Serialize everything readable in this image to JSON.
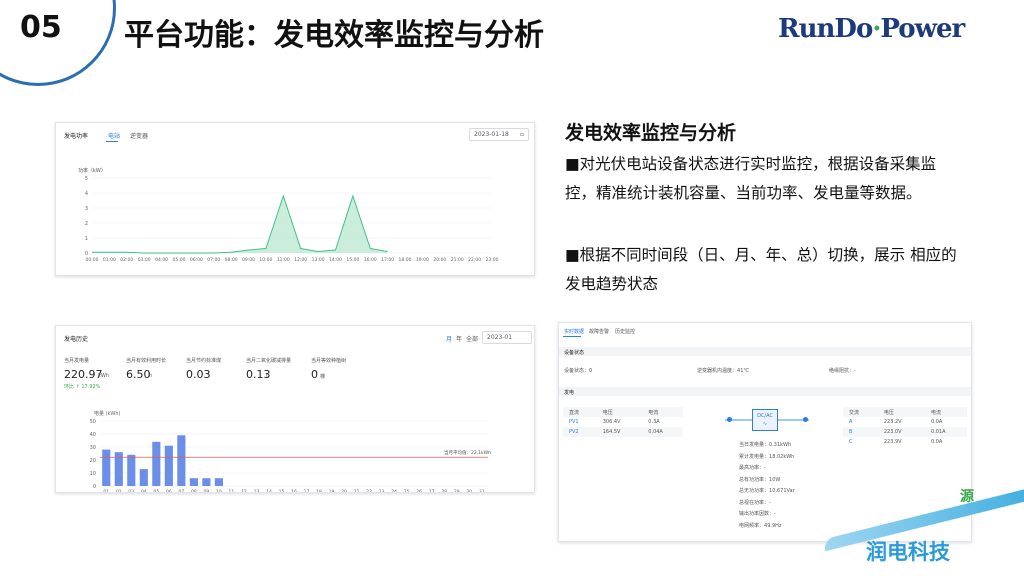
{
  "header": {
    "number": "05",
    "title": "平台功能：发电效率监控与分析",
    "logo_left": "RunDo",
    "logo_dot": "·",
    "logo_right": "Power"
  },
  "right_panel": {
    "title": "发电效率监控与分析",
    "bullets": [
      "■对光伏电站设备状态进行实时监控，根据设备采集监控，精准统计装机容量、当前功率、发电量等数据。",
      "■根据不同时间段（日、月、年、总）切换，展示 相应的发电趋势状态"
    ]
  },
  "power_card": {
    "title": "发电功率",
    "tabs": [
      "电站",
      "逆变器"
    ],
    "date": "2023-01-18",
    "ylabel": "功率（kW）",
    "y_ticks": [
      "0",
      "1",
      "2",
      "3",
      "4",
      "5"
    ],
    "x_ticks": [
      "00:00",
      "01:00",
      "02:00",
      "03:00",
      "04:00",
      "05:00",
      "06:00",
      "07:00",
      "08:00",
      "09:00",
      "10:00",
      "11:00",
      "12:00",
      "13:00",
      "14:00",
      "15:00",
      "16:00",
      "17:00",
      "18:00",
      "19:00",
      "20:00",
      "21:00",
      "22:00",
      "23:00"
    ]
  },
  "history_card": {
    "title": "发电历史",
    "switch": [
      "月",
      "年",
      "全部"
    ],
    "month": "2023-01",
    "stats": [
      {
        "label": "当月发电量",
        "value": "220.97",
        "unit": "kWh"
      },
      {
        "label": "当月有效利用时长",
        "value": "6.50",
        "unit": "h"
      },
      {
        "label": "当月节约标准煤",
        "value": "0.03",
        "unit": "t"
      },
      {
        "label": "当月二氧化碳减排量",
        "value": "0.13",
        "unit": "t"
      },
      {
        "label": "当月等效种植树",
        "value": "0",
        "unit": "棵"
      }
    ],
    "ratio": "环比 ↑ 17.92%",
    "avg_label": "当月平均值：22.1kWh"
  },
  "device_card": {
    "tabs": [
      "实时数据",
      "故障告警",
      "历史监控"
    ],
    "device_status_title": "设备状态",
    "status_items": [
      {
        "label": "设备状态：",
        "value": "0"
      },
      {
        "label": "逆变器机内温度：",
        "value": "41℃"
      },
      {
        "label": "绝缘阻抗：",
        "value": "-"
      }
    ],
    "power_title": "发电",
    "left_table": {
      "headers": [
        "直流",
        "电压",
        "电流"
      ],
      "rows": [
        [
          "PV1",
          "306.4V",
          "0.3A"
        ],
        [
          "PV2",
          "164.5V",
          "0.04A"
        ]
      ]
    },
    "inverter_label": "DC/AC",
    "mid_values": [
      {
        "label": "当日发电量：",
        "value": "0.31kWh"
      },
      {
        "label": "累计发电量：",
        "value": "18.02kWh"
      },
      {
        "label": "最高功率：",
        "value": "-"
      },
      {
        "label": "总有功功率：",
        "value": "10W"
      },
      {
        "label": "总无功功率：",
        "value": "10.671Var"
      },
      {
        "label": "总视在功率：",
        "value": "-"
      },
      {
        "label": "输出功率因数：",
        "value": "-"
      },
      {
        "label": "电网频率：",
        "value": "49.9Hz"
      }
    ],
    "right_table": {
      "headers": [
        "交流",
        "电压",
        "电流"
      ],
      "rows": [
        [
          "A",
          "223.2V",
          "0.0A"
        ],
        [
          "B",
          "223.0V",
          "0.01A"
        ],
        [
          "C",
          "223.9V",
          "0.0A"
        ]
      ]
    }
  },
  "footer": {
    "brand": "润电科技",
    "partial": "源"
  },
  "chart_data": [
    {
      "type": "area",
      "title": "发电功率",
      "ylabel": "功率（kW）",
      "ylim": [
        0,
        5
      ],
      "x": [
        "00:00",
        "01:00",
        "02:00",
        "03:00",
        "04:00",
        "05:00",
        "06:00",
        "07:00",
        "08:00",
        "09:00",
        "10:00",
        "11:00",
        "12:00",
        "13:00",
        "14:00",
        "15:00",
        "16:00",
        "17:00"
      ],
      "series": [
        {
          "values": [
            0.05,
            0.05,
            0.05,
            0,
            0,
            0,
            0,
            0,
            0.05,
            0.2,
            0.3,
            3.8,
            0.3,
            0.1,
            0.2,
            3.8,
            0.3,
            0.1
          ]
        }
      ]
    },
    {
      "type": "bar",
      "title": "发电历史",
      "ylabel": "电量 (kWh)",
      "ylim": [
        0,
        50
      ],
      "categories": [
        "01",
        "02",
        "03",
        "04",
        "05",
        "06",
        "07",
        "08",
        "09",
        "10",
        "11",
        "12",
        "13",
        "14",
        "15",
        "16",
        "17",
        "18",
        "19",
        "20",
        "21",
        "22",
        "23",
        "24",
        "25",
        "26",
        "27",
        "28",
        "29",
        "30",
        "31"
      ],
      "values": [
        28,
        26,
        24,
        13,
        34,
        31,
        39,
        6,
        6,
        6,
        0,
        0,
        0,
        0,
        0,
        0,
        0,
        0,
        0,
        0,
        0,
        0,
        0,
        0,
        0,
        0,
        0,
        0,
        0,
        0,
        0
      ],
      "average": 22.1
    }
  ]
}
